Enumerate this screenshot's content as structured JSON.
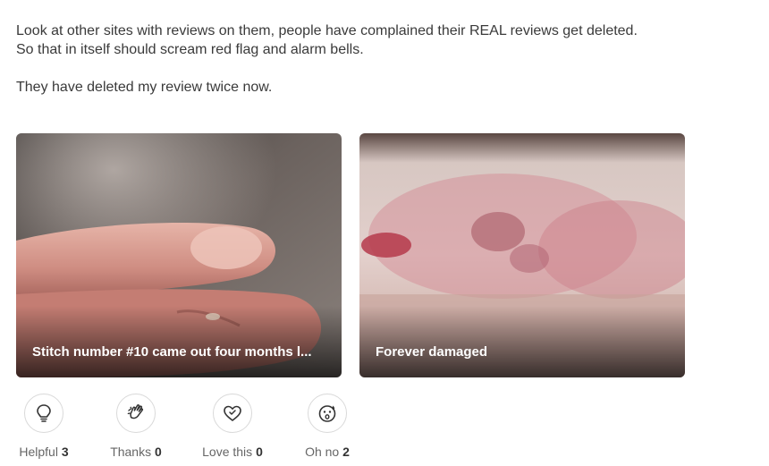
{
  "review": {
    "paragraph_1_line_1": "Look at other sites with reviews on them, people have complained their REAL reviews get deleted.",
    "paragraph_1_line_2": "So that in itself should scream red flag and alarm bells.",
    "paragraph_2": "They have deleted my review twice now."
  },
  "photos": [
    {
      "caption": "Stitch number #10 came out four months l..."
    },
    {
      "caption": "Forever damaged"
    }
  ],
  "reactions": [
    {
      "label": "Helpful",
      "count": "3",
      "icon": "lightbulb-icon"
    },
    {
      "label": "Thanks",
      "count": "0",
      "icon": "clapping-hands-icon"
    },
    {
      "label": "Love this",
      "count": "0",
      "icon": "heart-icon"
    },
    {
      "label": "Oh no",
      "count": "2",
      "icon": "surprised-face-icon"
    }
  ],
  "colors": {
    "text": "#3a3a3a",
    "muted": "#666666",
    "border": "#d9d9d9"
  }
}
